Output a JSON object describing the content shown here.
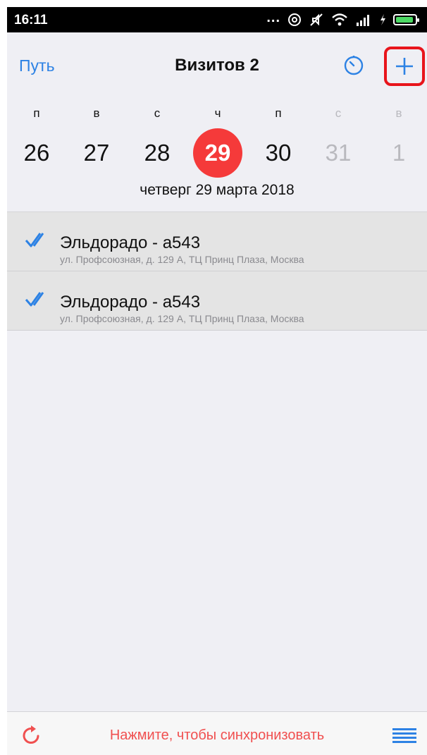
{
  "status_bar": {
    "time": "16:11",
    "more": "...",
    "icons": [
      "location-icon",
      "mute-icon",
      "wifi-icon",
      "signal-icon",
      "charging-icon",
      "battery-icon"
    ]
  },
  "header": {
    "route_label": "Путь",
    "title": "Визитов 2",
    "accent_color": "#2d82e4",
    "highlight_color": "#e8141b"
  },
  "week": {
    "days": [
      {
        "dow": "п",
        "num": "26",
        "state": "normal"
      },
      {
        "dow": "в",
        "num": "27",
        "state": "normal"
      },
      {
        "dow": "с",
        "num": "28",
        "state": "normal"
      },
      {
        "dow": "ч",
        "num": "29",
        "state": "active"
      },
      {
        "dow": "п",
        "num": "30",
        "state": "normal"
      },
      {
        "dow": "с",
        "num": "31",
        "state": "muted"
      },
      {
        "dow": "в",
        "num": "1",
        "state": "muted"
      }
    ],
    "selected_date": "четверг  29 марта 2018",
    "active_color": "#f53a3a"
  },
  "visits": [
    {
      "name": "Эльдорадо - а543",
      "address": "ул. Профсоюзная, д. 129 А, ТЦ Принц Плаза, Москва",
      "status_icon": "double-check-icon"
    },
    {
      "name": "Эльдорадо - а543",
      "address": "ул. Профсоюзная, д. 129 А, ТЦ Принц Плаза, Москва",
      "status_icon": "double-check-icon"
    }
  ],
  "bottom_bar": {
    "sync_text": "Нажмите, чтобы синхронизовать",
    "sync_color": "#f05050"
  }
}
